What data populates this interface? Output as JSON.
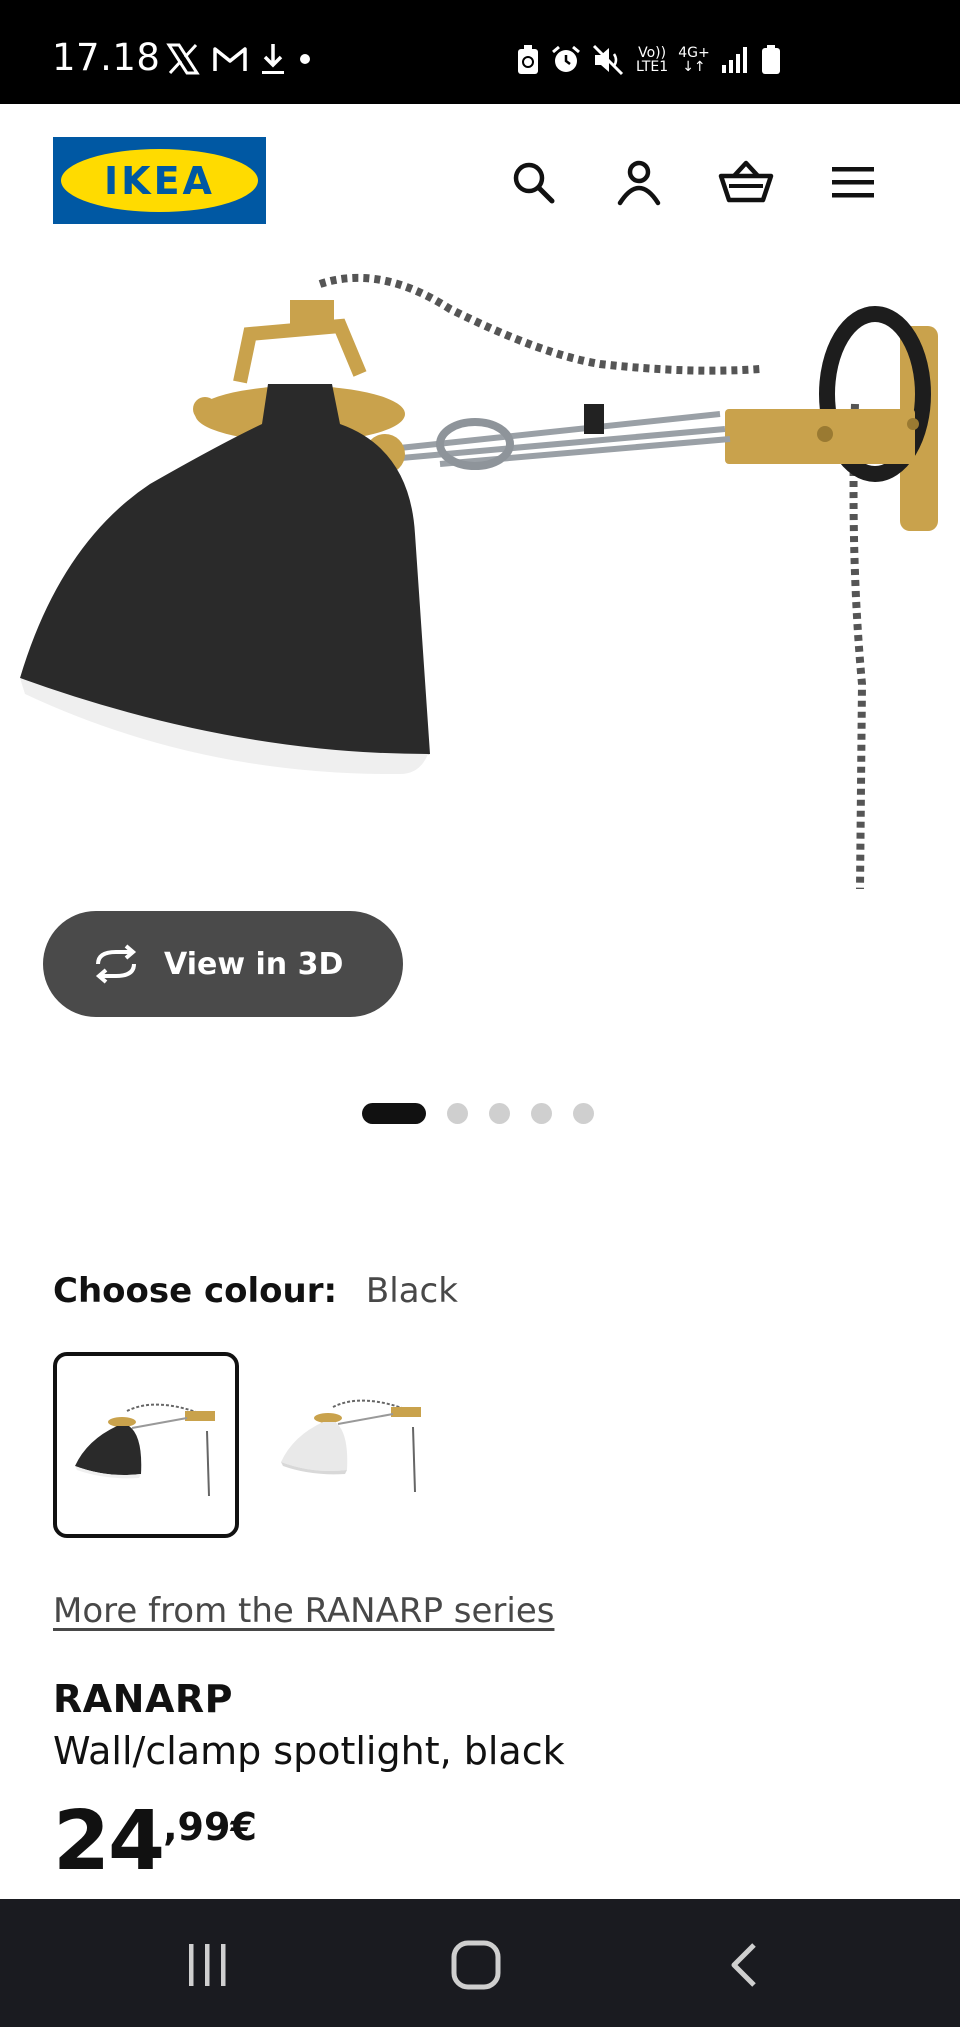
{
  "status_bar": {
    "time": "17.18",
    "network_top": "Vo))",
    "network_bottom": "LTE1",
    "data_type": "4G+"
  },
  "header": {
    "logo_text": "IKEA",
    "icons": [
      "search-icon",
      "account-icon",
      "basket-icon",
      "menu-icon"
    ]
  },
  "gallery": {
    "view_3d_label": "View in 3D",
    "image_count": 5,
    "active_index": 0
  },
  "colour": {
    "label": "Choose colour:",
    "value": "Black",
    "options": [
      "Black",
      "White"
    ],
    "selected_index": 0
  },
  "series_link": "More from the RANARP series",
  "product": {
    "name": "RANARP",
    "description": "Wall/clamp spotlight, black",
    "price_integer": "24",
    "price_decimal": ",99€"
  },
  "colors": {
    "ikea_blue": "#0058a3",
    "ikea_yellow": "#ffdb00",
    "lamp_black": "#2a2a2a",
    "brass": "#c9a24c"
  }
}
